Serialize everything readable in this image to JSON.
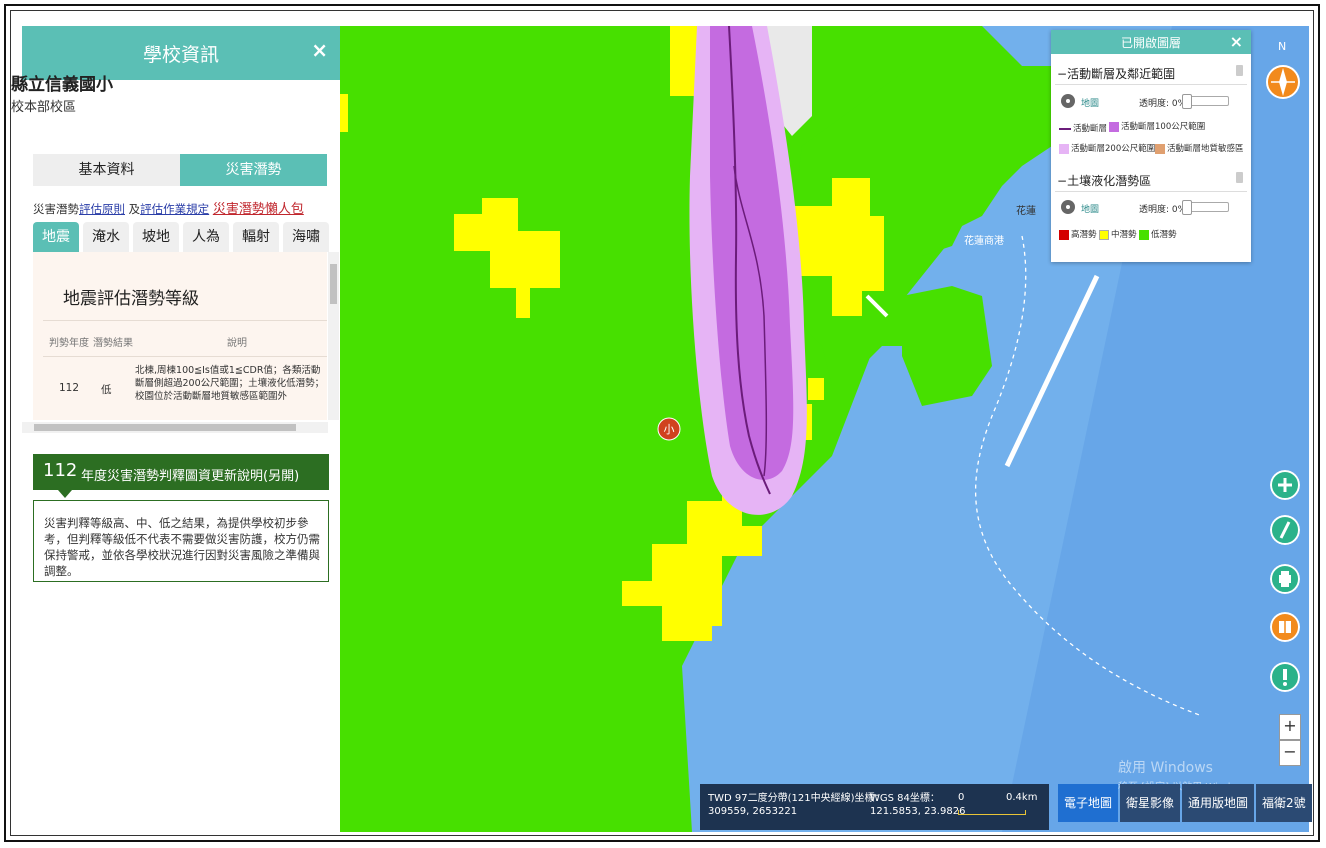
{
  "panel": {
    "title": "學校資訊",
    "close": "×",
    "school_name": "縣立信義國小",
    "campus": "校本部校區",
    "tabs": [
      "基本資料",
      "災害潛勢"
    ],
    "links_prefix": "災害潛勢",
    "link1": "評估原則",
    "links_mid": " 及",
    "link2": "評估作業規定",
    "link3": "災害潛勢懶人包",
    "hazard_tabs": [
      "地震",
      "淹水",
      "坡地",
      "人為",
      "輻射",
      "海嘯"
    ],
    "active_hazard": "地震",
    "content_title": "地震評估潛勢等級",
    "table_headers": [
      "判勢年度",
      "潛勢結果",
      "說明"
    ],
    "row": {
      "year": "112",
      "result": "低",
      "desc": "北棟,周棟100≦Is值或1≦CDR值；各類活動斷層側超過200公尺範圍；土壤液化低潛勢；校園位於活動斷層地質敏感區範圍外"
    },
    "update_year": "112",
    "update_text": "年度災害潛勢判釋圖資更新說明(另開)",
    "note": "災害判釋等級高、中、低之結果，為提供學校初步參考，但判釋等級低不代表不需要做災害防護，校方仍需保持警戒，並依各學校狀況進行因對災害風險之準備與調整。"
  },
  "legend": {
    "title": "已開啟圖層",
    "close": "×",
    "section1": {
      "title": "活動斷層及鄰近範圍",
      "layer_label": "地圖",
      "opacity": "透明度: 0%",
      "opacity_value": 0,
      "items": [
        "活動斷層",
        "活動斷層100公尺範圍",
        "活動斷層200公尺範圍",
        "活動斷層地質敏感區"
      ]
    },
    "section2": {
      "title": "土壤液化潛勢區",
      "layer_label": "地圖",
      "opacity": "透明度: 0%",
      "opacity_value": 0,
      "items": [
        "高潛勢",
        "中潛勢",
        "低潛勢"
      ]
    }
  },
  "map": {
    "school_marker": "小",
    "north": "N",
    "label_hualien": "花蓮",
    "label_port": "花蓮商港"
  },
  "coords": {
    "twd_label": "TWD 97二度分帶(121中央經線)坐標：",
    "twd_value": "309559, 2653221",
    "wgs_label": "WGS 84坐標：",
    "wgs_value": "121.5853, 23.9826",
    "scale_start": "0",
    "scale_end": "0.4km"
  },
  "basemaps": [
    "電子地圖",
    "衛星影像",
    "通用版地圖",
    "福衛2號"
  ],
  "zoom": {
    "in": "+",
    "out": "−"
  },
  "watermark": "啟用 Windows",
  "watermark_sub": "移至 [設定] 以啟用 Windows",
  "colors": {
    "teal": "#5bbfb5",
    "low": "#47e000",
    "mid": "#ffff00",
    "high": "#d40000",
    "fault100": "#c46be0",
    "fault200": "#e6b4f5",
    "sea": "#72b0ec"
  }
}
